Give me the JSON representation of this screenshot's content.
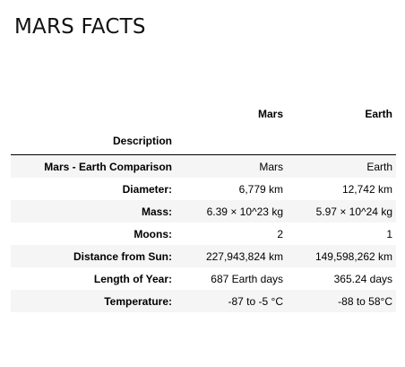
{
  "page": {
    "title": "MARS FACTS"
  },
  "table": {
    "columns": [
      "",
      "Mars",
      "Earth"
    ],
    "index_header": "Description",
    "rows": [
      {
        "label": "Mars - Earth Comparison",
        "mars": "Mars",
        "earth": "Earth"
      },
      {
        "label": "Diameter:",
        "mars": "6,779 km",
        "earth": "12,742 km"
      },
      {
        "label": "Mass:",
        "mars": "6.39 × 10^23 kg",
        "earth": "5.97 × 10^24 kg"
      },
      {
        "label": "Moons:",
        "mars": "2",
        "earth": "1"
      },
      {
        "label": "Distance from Sun:",
        "mars": "227,943,824 km",
        "earth": "149,598,262 km"
      },
      {
        "label": "Length of Year:",
        "mars": "687 Earth days",
        "earth": "365.24 days"
      },
      {
        "label": "Temperature:",
        "mars": "-87 to -5 °C",
        "earth": "-88 to 58°C"
      }
    ]
  },
  "colors": {
    "stripe": "#f5f5f5",
    "header_rule": "#000000",
    "text": "#000000"
  }
}
